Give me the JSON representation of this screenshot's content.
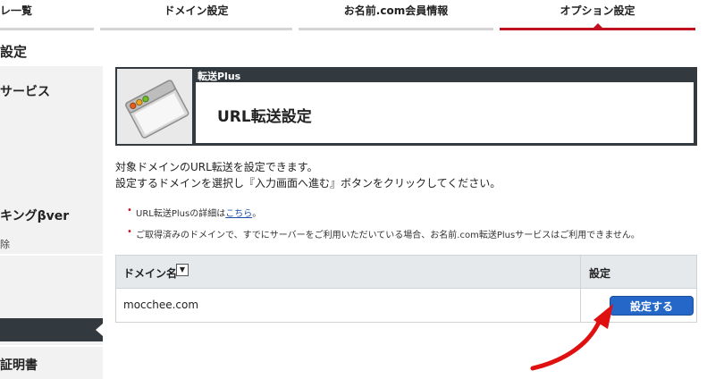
{
  "tabs": [
    {
      "label": "レ一覧"
    },
    {
      "label": "ドメイン設定"
    },
    {
      "label": "お名前.com会員情報"
    },
    {
      "label": "オプション設定"
    }
  ],
  "page_title": "設定",
  "sidebar": {
    "items": [
      {
        "label": "サービス"
      },
      {
        "label": "キングβver"
      },
      {
        "label": "除"
      },
      {
        "label": "証明書"
      }
    ]
  },
  "service": {
    "name": "転送Plus",
    "title": "URL転送設定"
  },
  "description": {
    "line1": "対象ドメインのURL転送を設定できます。",
    "line2": "設定するドメインを選択し『入力画面へ進む』ボタンをクリックしてください。"
  },
  "notes": {
    "note1_prefix": "URL転送Plusの詳細は",
    "note1_link": "こちら",
    "note1_suffix": "。",
    "note2": "ご取得済みのドメインで、すでにサーバーをご利用いただいている場合、お名前.com転送Plusサービスはご利用できません。"
  },
  "table": {
    "col_domain": "ドメイン名",
    "col_setting": "設定",
    "rows": [
      {
        "domain": "mocchee.com",
        "button": "設定する"
      }
    ]
  },
  "colors": {
    "accent_red": "#c0111f",
    "header_dark": "#333a3f",
    "button_blue": "#2567c9"
  }
}
